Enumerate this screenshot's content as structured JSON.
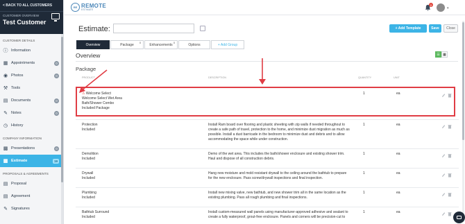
{
  "sidebar": {
    "back_label": "< BACK TO ALL CUSTOMERS",
    "overview_label": "CUSTOMER OVERVIEW",
    "customer_name": "Test Customer",
    "sections": {
      "details": "CUSTOMER DETAILS",
      "company": "COMPANY INFORMATION",
      "proposals": "PROPOSALS & AGREEMENTS"
    },
    "details_items": [
      {
        "label": "Information",
        "count": null
      },
      {
        "label": "Appointments",
        "count": "0"
      },
      {
        "label": "Photos",
        "count": "0"
      },
      {
        "label": "Tools",
        "count": null
      },
      {
        "label": "Documents",
        "count": "0"
      },
      {
        "label": "Notes",
        "count": "0"
      },
      {
        "label": "History",
        "count": null
      }
    ],
    "company_items": [
      {
        "label": "Presentations",
        "count": "0"
      },
      {
        "label": "Estimate",
        "count": "19"
      }
    ],
    "proposal_items": [
      {
        "label": "Proposal",
        "count": null
      },
      {
        "label": "Agreement",
        "count": null
      },
      {
        "label": "Signatures",
        "count": null
      }
    ]
  },
  "topbar": {
    "logo_top": "REMOTE",
    "logo_bottom": "ESTIMATE",
    "logo_mark": "RE",
    "notification_count": "0"
  },
  "estimate": {
    "label": "Estimate:",
    "name_value": "",
    "add_template_label": "+ Add Template",
    "save_label": "Save",
    "close_label": "Close"
  },
  "tabs": [
    {
      "label": "Overview",
      "sup": ""
    },
    {
      "label": "Package",
      "sup": "0"
    },
    {
      "label": "Enhancements",
      "sup": "0"
    },
    {
      "label": "Options",
      "sup": ""
    },
    {
      "label": "+ Add Group",
      "sup": ""
    }
  ],
  "overview_title": "Overview",
  "package_title": "Package",
  "columns": {
    "product": "PRODUCT",
    "description": "DESCRIPTION",
    "quantity": "QUANTITY",
    "unit": "UNIT"
  },
  "rows": [
    {
      "product": [
        "Welcome Select",
        "Welcome Select Wet Area",
        "Bath/Shower Combo",
        "Included Package"
      ],
      "description": [],
      "quantity": "1",
      "unit": "ea"
    },
    {
      "product": [
        "Protection",
        "Included"
      ],
      "description": [
        "Install Ram board over flooring and plastic sheeting with zip walls if needed throughout to",
        "create a safe path of travel, protection to the home, and minimize dust migration as much as",
        "possible. Install a dust barricade in the bedroom to minimize dust and debris and to allow",
        "accommodating the space while under construction."
      ],
      "quantity": "1",
      "unit": "ea"
    },
    {
      "product": [
        "Demolition",
        "Included"
      ],
      "description": [
        "Demo of the wet area. This includes the bath/shower enclosure and existing shower trim.",
        "Haul and dispose of all construction debris."
      ],
      "quantity": "1",
      "unit": "ea"
    },
    {
      "product": [
        "Drywall",
        "Included"
      ],
      "description": [
        "Hang new moisture and mold resistant drywall to the ceiling around the bathtub to prepare",
        "for the new enclosure. Pass screw/drywall inspections and final inspection."
      ],
      "quantity": "1",
      "unit": "ea"
    },
    {
      "product": [
        "Plumbing",
        "Included"
      ],
      "description": [
        "Install new mixing valve, new bathtub, and new shower trim all in the same location as the",
        "existing plumbing. Pass all rough plumbing and final inspections."
      ],
      "quantity": "1",
      "unit": "ea"
    },
    {
      "product": [
        "Bathtub Surround",
        "Included"
      ],
      "description": [
        "Install custom-measured wall panels using manufacturer-approved adhesive and sealant to",
        "create a fully waterproof, grout-free enclosure. Panels and corners will be precision-cut to"
      ],
      "quantity": "1",
      "unit": "ea"
    }
  ],
  "colors": {
    "sidebar_dark": "#1f2a38",
    "accent": "#3cb4e6",
    "highlight": "#e03c44",
    "green": "#5bb85d"
  }
}
